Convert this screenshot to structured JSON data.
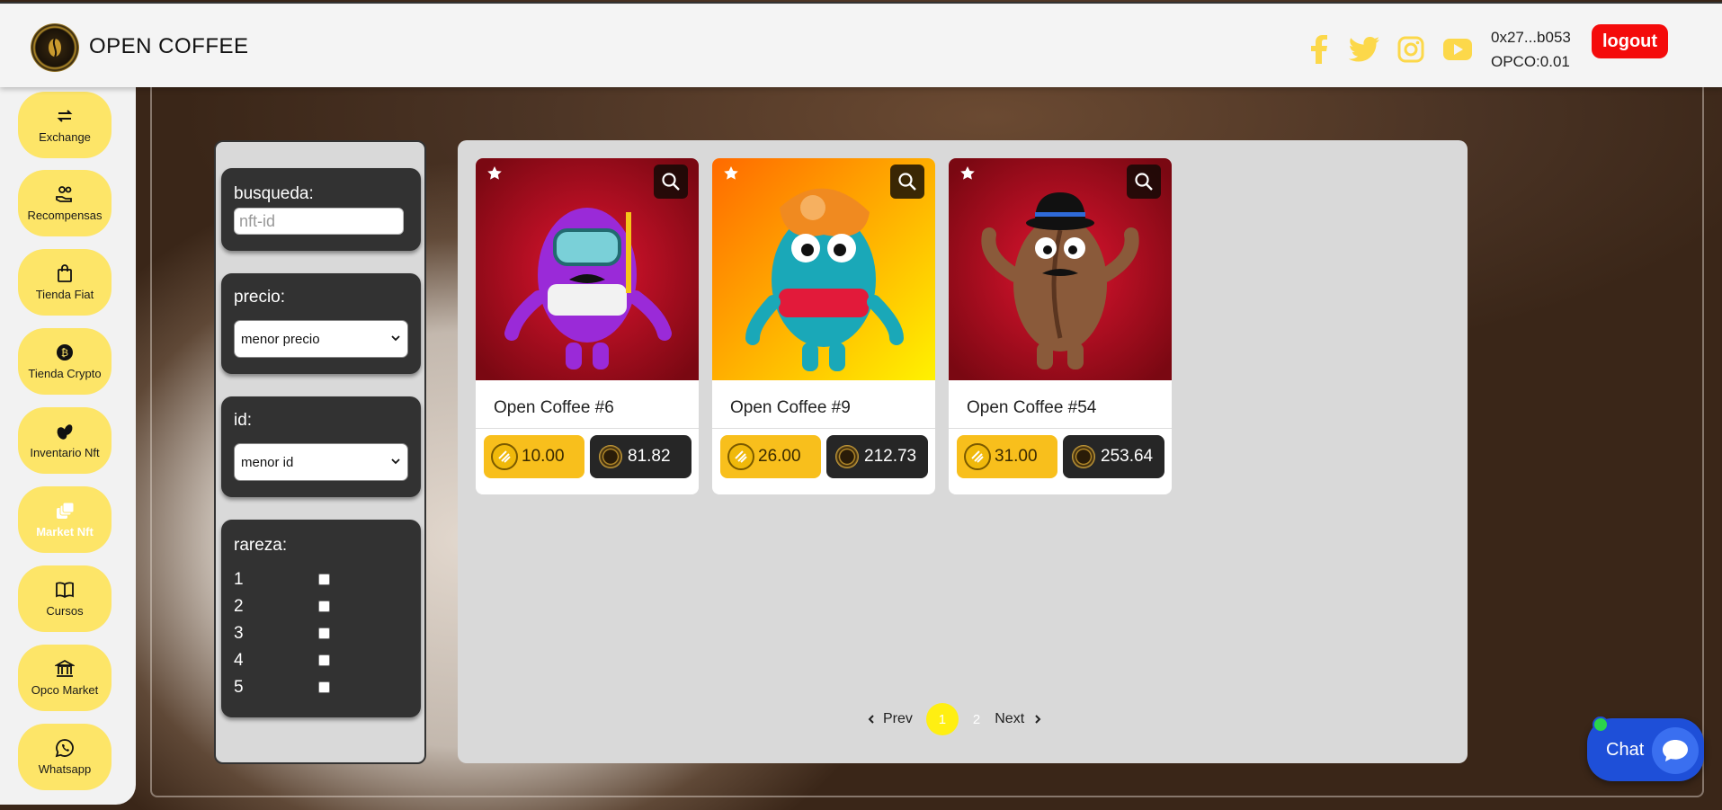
{
  "header": {
    "brand": "OPEN COFFEE",
    "wallet_address": "0x27...b053",
    "wallet_balance": "OPCO:0.01",
    "logout_label": "logout",
    "social_icons": [
      "facebook-icon",
      "twitter-icon",
      "instagram-icon",
      "youtube-icon"
    ],
    "social_color": "#fcd84a"
  },
  "sidebar": {
    "items": [
      {
        "label": "Exchange",
        "icon": "exchange-icon"
      },
      {
        "label": "Recompensas",
        "icon": "rewards-icon"
      },
      {
        "label": "Tienda Fiat",
        "icon": "shopping-bag-icon"
      },
      {
        "label": "Tienda Crypto",
        "icon": "crypto-coin-icon"
      },
      {
        "label": "Inventario Nft",
        "icon": "coffee-beans-icon"
      },
      {
        "label": "Market Nft",
        "icon": "cards-icon",
        "active": true
      },
      {
        "label": "Cursos",
        "icon": "book-icon"
      },
      {
        "label": "Opco Market",
        "icon": "bank-icon"
      },
      {
        "label": "Whatsapp",
        "icon": "whatsapp-icon"
      }
    ],
    "color": "#fde568"
  },
  "filters": {
    "search_label": "busqueda:",
    "search_placeholder": "nft-id",
    "price_label": "precio:",
    "price_selected": "menor precio",
    "id_label": "id:",
    "id_selected": "menor id",
    "rarity_label": "rareza:",
    "rarity_options": [
      "1",
      "2",
      "3",
      "4",
      "5"
    ]
  },
  "cards": [
    {
      "name": "Open Coffee #6",
      "price_busd": "10.00",
      "price_opco": "81.82",
      "bg": "crimson",
      "character": "diver"
    },
    {
      "name": "Open Coffee #9",
      "price_busd": "26.00",
      "price_opco": "212.73",
      "bg": "orange",
      "character": "flower"
    },
    {
      "name": "Open Coffee #54",
      "price_busd": "31.00",
      "price_opco": "253.64",
      "bg": "crimson",
      "character": "bowler"
    }
  ],
  "pagination": {
    "prev_label": "Prev",
    "pages": [
      "1",
      "2"
    ],
    "current": "1",
    "next_label": "Next"
  },
  "chat": {
    "label": "Chat"
  }
}
